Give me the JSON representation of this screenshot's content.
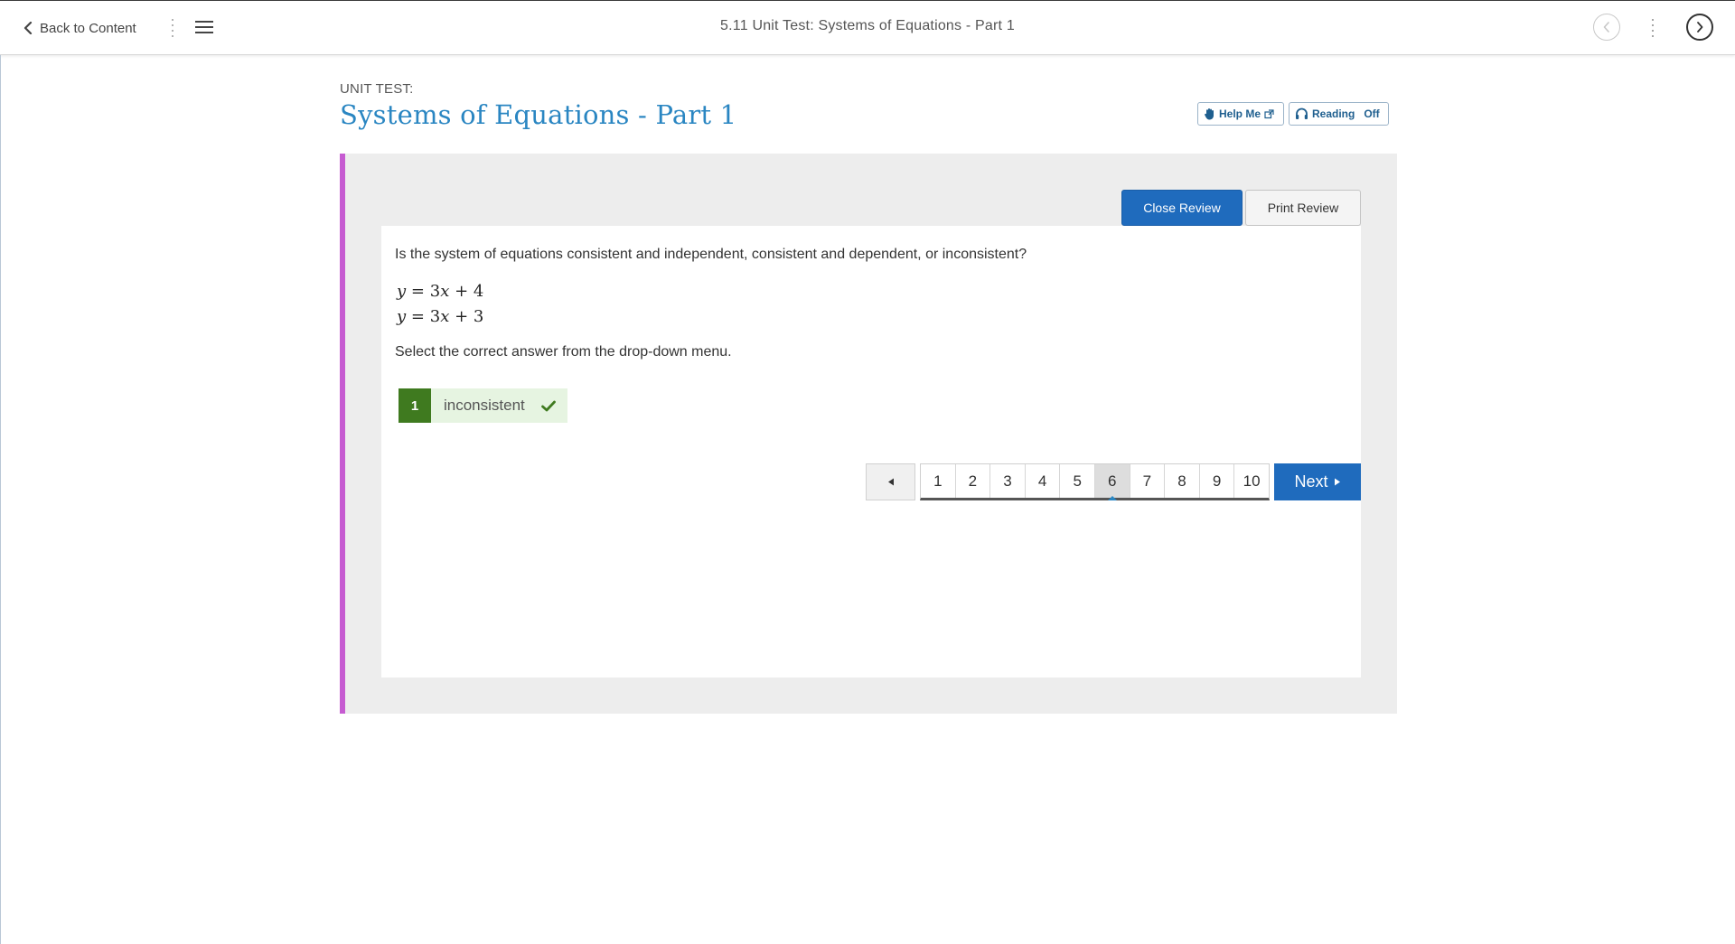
{
  "topbar": {
    "back_label": "Back to Content",
    "title": "5.11 Unit Test: Systems of Equations - Part 1"
  },
  "header": {
    "kicker": "UNIT TEST:",
    "title": "Systems of Equations - Part 1",
    "help_label": "Help Me",
    "reading_label": "Reading",
    "reading_state": "Off"
  },
  "review": {
    "close_label": "Close Review",
    "print_label": "Print Review"
  },
  "question": {
    "prompt": "Is the system of equations consistent and independent, consistent and dependent, or inconsistent?",
    "equations": [
      {
        "lhs": "y",
        "rel": "=",
        "coef": "3",
        "var": "x",
        "op": "+",
        "const": "4"
      },
      {
        "lhs": "y",
        "rel": "=",
        "coef": "3",
        "var": "x",
        "op": "+",
        "const": "3"
      }
    ],
    "instruction": "Select the correct answer from the drop-down menu.",
    "answer": {
      "number": "1",
      "value": "inconsistent",
      "status": "correct"
    }
  },
  "pagination": {
    "pages": [
      "1",
      "2",
      "3",
      "4",
      "5",
      "6",
      "7",
      "8",
      "9",
      "10"
    ],
    "current": "6",
    "next_label": "Next"
  },
  "colors": {
    "accent_blue": "#1f6bbd",
    "title_blue": "#2a86c2",
    "panel_stripe": "#c65bd1",
    "correct_green": "#3f7a1f",
    "answer_bg": "#e6f4e1"
  },
  "icons": {
    "back": "chevron-left-icon",
    "menu": "hamburger-icon",
    "prev_activity": "circle-chevron-left-icon",
    "next_activity": "circle-chevron-right-icon",
    "help": "hand-icon",
    "external": "external-link-icon",
    "reading": "headphones-icon",
    "check": "checkmark-icon"
  }
}
